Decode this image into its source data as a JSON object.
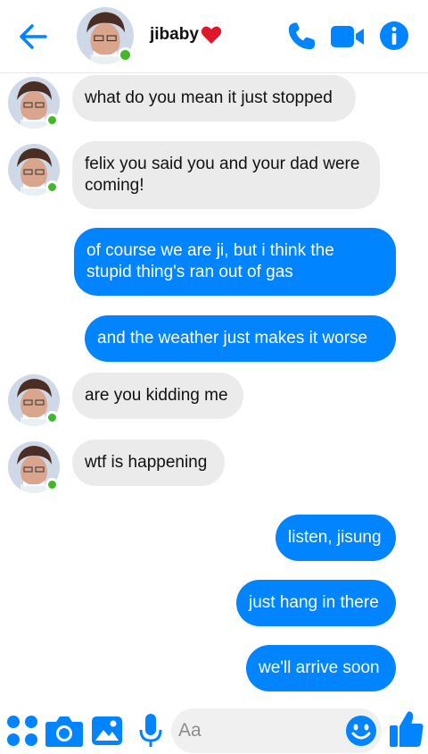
{
  "header": {
    "contact_name": "jibaby",
    "status_color": "#42b72a",
    "accent": "#0084ff",
    "icons": [
      "back-arrow-icon",
      "heart-icon",
      "phone-icon",
      "video-camera-icon",
      "info-icon"
    ]
  },
  "messages": [
    {
      "side": "incoming",
      "lines": [
        "what do you mean it just stopped"
      ]
    },
    {
      "side": "incoming",
      "lines": [
        "felix you said you and your dad were",
        "coming!"
      ]
    },
    {
      "side": "outgoing",
      "lines": [
        "of course we are ji, but i think the",
        "stupid thing's ran out of gas"
      ]
    },
    {
      "side": "outgoing",
      "lines": [
        "and the weather just makes it worse"
      ]
    },
    {
      "side": "incoming",
      "lines": [
        "are you kidding me"
      ]
    },
    {
      "side": "incoming",
      "lines": [
        "wtf is happening"
      ]
    },
    {
      "side": "outgoing",
      "lines": [
        "listen, jisung"
      ]
    },
    {
      "side": "outgoing",
      "lines": [
        "just hang in there"
      ]
    },
    {
      "side": "outgoing",
      "lines": [
        "we'll arrive soon"
      ]
    }
  ],
  "composer": {
    "placeholder": "Aa",
    "icons": [
      "apps-grid-icon",
      "camera-icon",
      "photo-gallery-icon",
      "microphone-icon",
      "emoji-icon",
      "thumbs-up-icon"
    ]
  }
}
